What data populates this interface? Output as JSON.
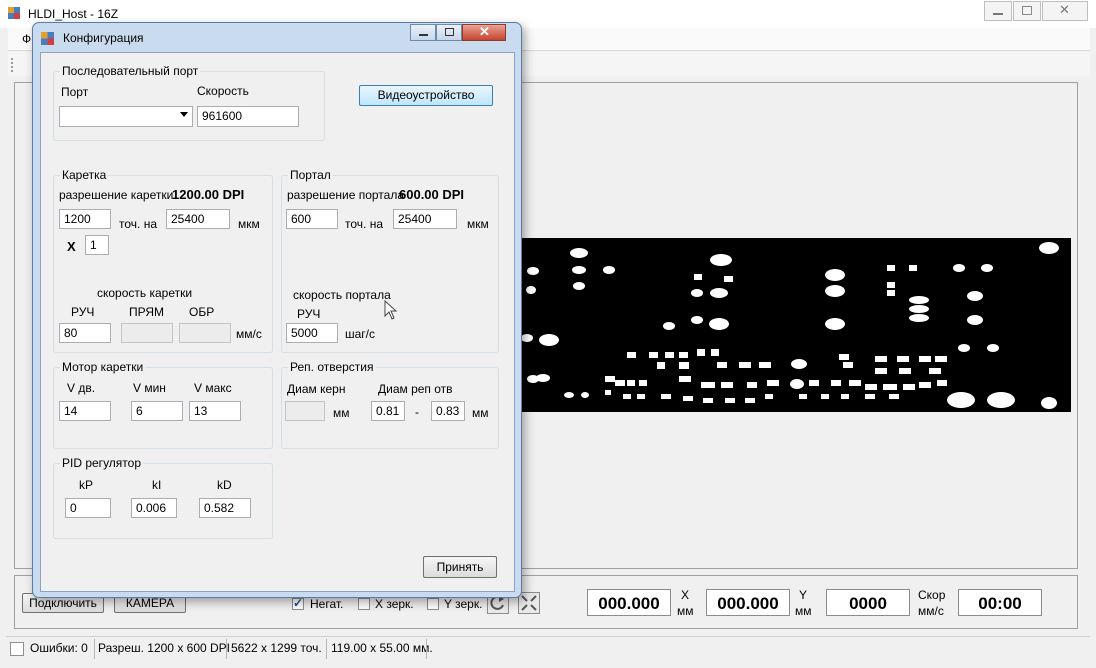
{
  "main_window": {
    "title": "HLDI_Host - 16Z",
    "menu_first_label": "Ф",
    "bottom": {
      "connect_button": "Подключить",
      "camera_button": "КАМЕРА",
      "neg_label": "Негат.",
      "neg_checked": true,
      "xmirror_label": "X зерк.",
      "ymirror_label": "Y зерк.",
      "x_value": "000.000",
      "x_label": "X",
      "x_unit": "мм",
      "y_value": "000.000",
      "y_label": "Y",
      "y_unit": "мм",
      "speed_value": "0000",
      "speed_label": "Скор",
      "speed_unit": "мм/с",
      "time_value": "00:00"
    },
    "status": {
      "errors": "Ошибки: 0",
      "resolution": "Разреш. 1200 x 600 DPI",
      "points": "5622 x 1299 точ.",
      "size": "119.00 x 55.00 мм."
    }
  },
  "dialog": {
    "title": "Конфигурация",
    "serial": {
      "group": "Последовательный порт",
      "port_label": "Порт",
      "port_value": "",
      "speed_label": "Скорость",
      "speed_value": "961600"
    },
    "video_button": "Видеоустройство",
    "carriage": {
      "group": "Каретка",
      "res_label": "разрешение каретки",
      "res_value": "1200.00 DPI",
      "dots": "1200",
      "dots_label": "точ. на",
      "um": "25400",
      "um_label": "мкм",
      "x_label": "X",
      "x_value": "1",
      "speed_title": "скорость каретки",
      "ruch_label": "РУЧ",
      "pryam_label": "ПРЯМ",
      "obr_label": "ОБР",
      "ruch_value": "80",
      "speed_unit": "мм/с"
    },
    "portal": {
      "group": "Портал",
      "res_label": "разрешение портала",
      "res_value": "600.00 DPI",
      "dots": "600",
      "dots_label": "точ. на",
      "um": "25400",
      "um_label": "мкм",
      "speed_title": "скорость портала",
      "ruch_label": "РУЧ",
      "ruch_value": "5000",
      "speed_unit": "шаг/с"
    },
    "motor": {
      "group": "Мотор каретки",
      "v_label": "V дв.",
      "vmin_label": "V мин",
      "vmax_label": "V макс",
      "v_value": "14",
      "vmin_value": "6",
      "vmax_value": "13"
    },
    "holes": {
      "group": "Реп. отверстия",
      "core_label": "Диам керн",
      "rep_label": "Диам реп отв",
      "mm1": "мм",
      "rep_min": "0.81",
      "dash": "-",
      "rep_max": "0.83",
      "mm2": "мм"
    },
    "pid": {
      "group": "PID регулятор",
      "kp_label": "kP",
      "ki_label": "kI",
      "kd_label": "kD",
      "kp_value": "0",
      "ki_value": "0.006",
      "kd_value": "0.582"
    },
    "accept_button": "Принять"
  }
}
